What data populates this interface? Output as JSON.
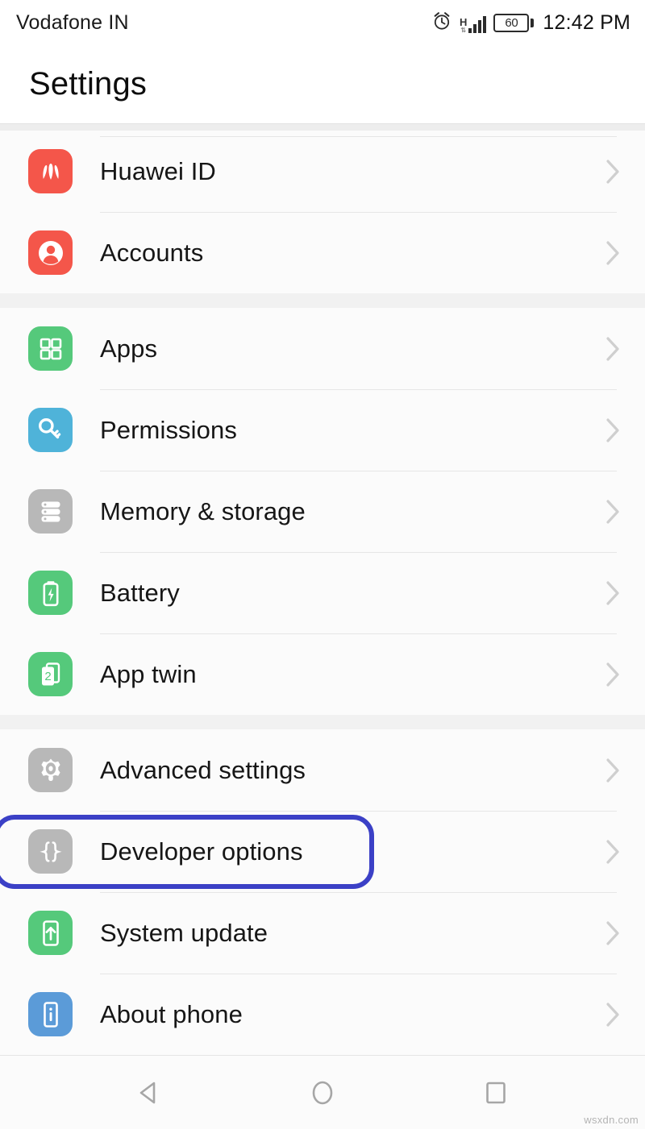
{
  "statusbar": {
    "carrier": "Vodafone IN",
    "alarm_icon": "alarm-clock-icon",
    "network_type": "H",
    "signal_icon": "signal-bars-icon",
    "battery_level": "60",
    "time": "12:42 PM"
  },
  "header": {
    "title": "Settings"
  },
  "colors": {
    "huawei_red": "#f4564a",
    "accounts_red": "#f4564a",
    "apps_green": "#55c97b",
    "permissions_blue": "#4fb3d9",
    "memory_gray": "#b8b8b8",
    "battery_green": "#55c97b",
    "apptwin_green": "#55c97b",
    "advanced_gray": "#b8b8b8",
    "developer_gray": "#b8b8b8",
    "update_green": "#55c97b",
    "about_blue": "#5b9bd8",
    "highlight_border": "#3b40c6",
    "chevron_gray": "#cfcfcf",
    "nav_gray": "#a6a6a6"
  },
  "groups": [
    {
      "items": [
        {
          "label": "Huawei ID",
          "icon": "huawei-logo-icon",
          "chevron": "chevron-right-icon",
          "highlighted": false
        },
        {
          "label": "Accounts",
          "icon": "person-account-icon",
          "chevron": "chevron-right-icon",
          "highlighted": false
        }
      ]
    },
    {
      "items": [
        {
          "label": "Apps",
          "icon": "apps-grid-icon",
          "chevron": "chevron-right-icon",
          "highlighted": false
        },
        {
          "label": "Permissions",
          "icon": "key-icon",
          "chevron": "chevron-right-icon",
          "highlighted": false
        },
        {
          "label": "Memory & storage",
          "icon": "storage-rack-icon",
          "chevron": "chevron-right-icon",
          "highlighted": false
        },
        {
          "label": "Battery",
          "icon": "battery-bolt-icon",
          "chevron": "chevron-right-icon",
          "highlighted": false
        },
        {
          "label": "App twin",
          "icon": "app-twin-cards-icon",
          "chevron": "chevron-right-icon",
          "highlighted": false
        }
      ]
    },
    {
      "items": [
        {
          "label": "Advanced settings",
          "icon": "gear-icon",
          "chevron": "chevron-right-icon",
          "highlighted": false
        },
        {
          "label": "Developer options",
          "icon": "curly-braces-icon",
          "chevron": "chevron-right-icon",
          "highlighted": true
        },
        {
          "label": "System update",
          "icon": "phone-up-arrow-icon",
          "chevron": "chevron-right-icon",
          "highlighted": false
        },
        {
          "label": "About phone",
          "icon": "phone-info-icon",
          "chevron": "chevron-right-icon",
          "highlighted": false
        }
      ]
    }
  ],
  "navbar": {
    "back": "back-triangle-icon",
    "home": "home-circle-icon",
    "recents": "recents-square-icon"
  },
  "watermark": "wsxdn.com"
}
